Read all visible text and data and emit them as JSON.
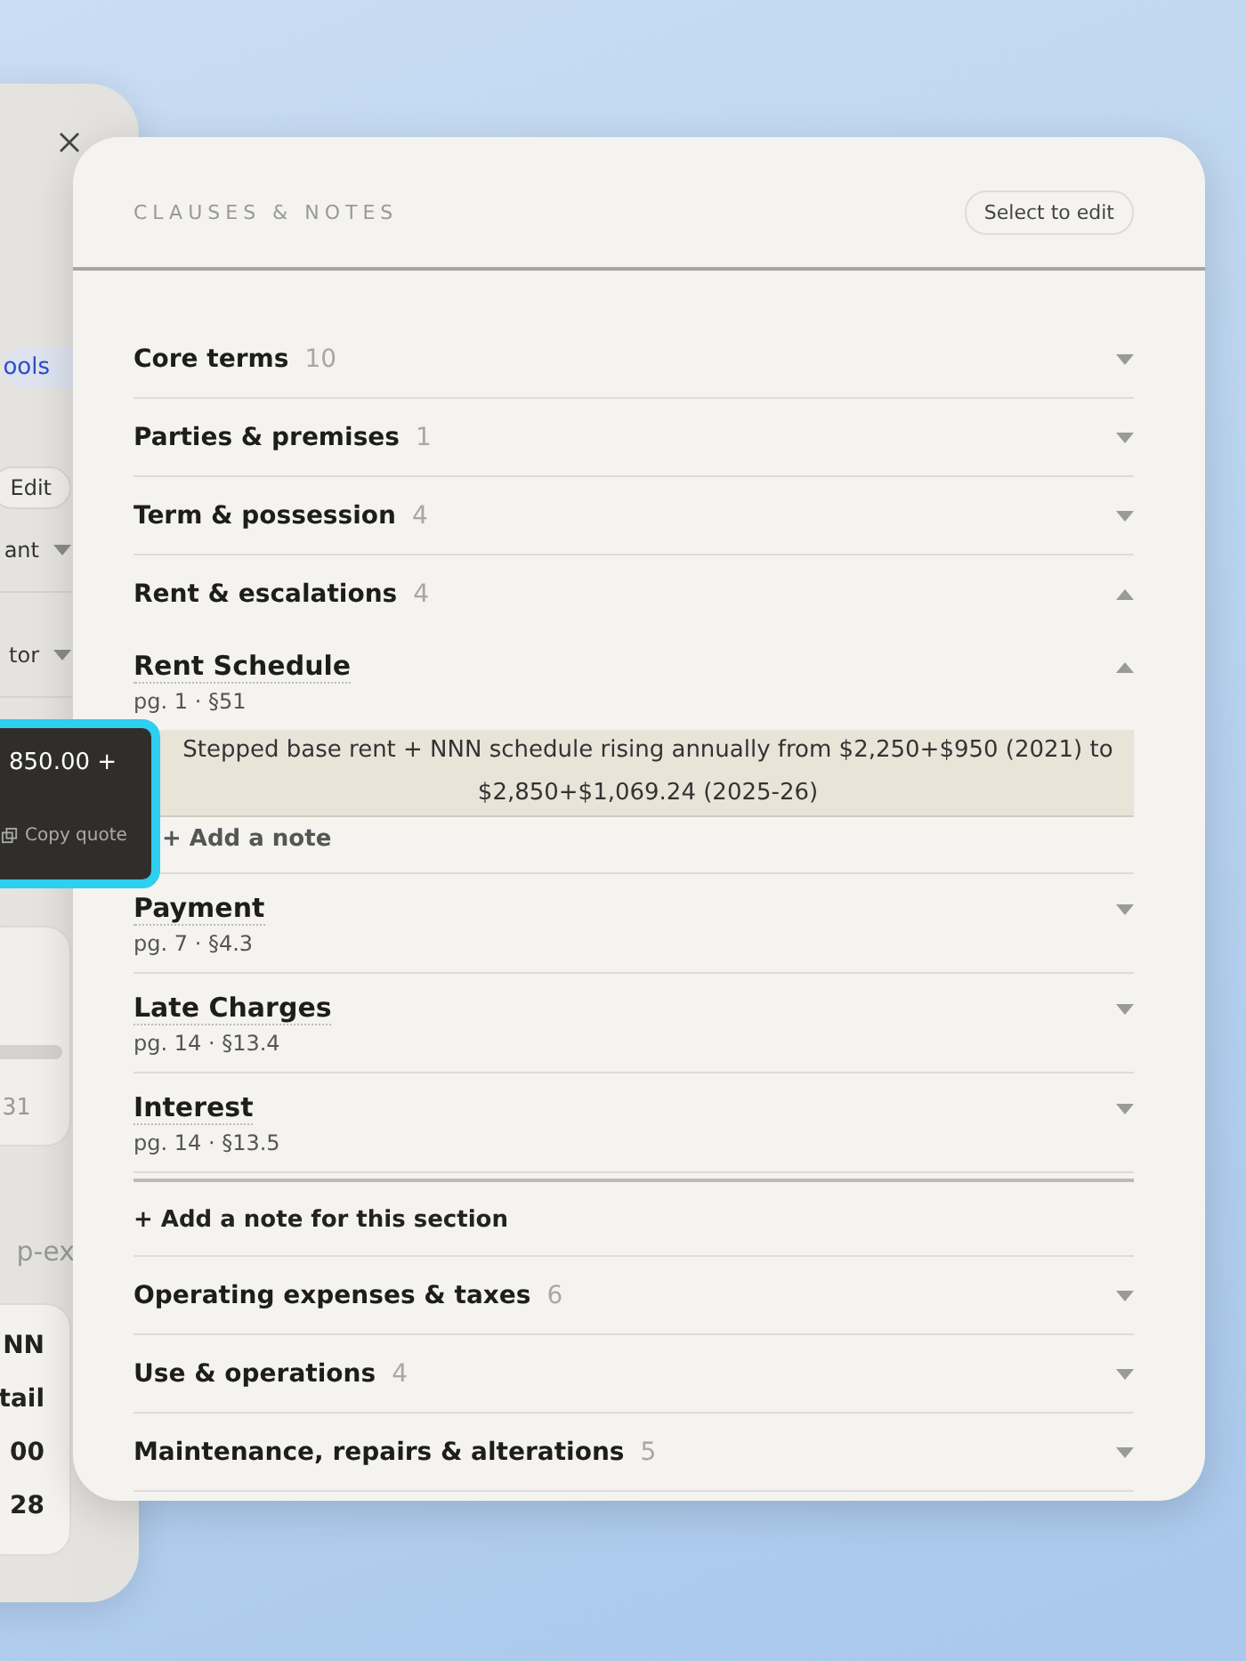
{
  "back_panel": {
    "tab_chip": "ools",
    "edit_button": "Edit",
    "dropdowns": [
      "ant",
      "tor"
    ],
    "card_value": "31",
    "section_label": "p-ex",
    "summary_lines": [
      "NN",
      "tail",
      "00",
      "28"
    ]
  },
  "tooltip": {
    "amount": "850.00 +",
    "copy_button": "Copy quote"
  },
  "panel": {
    "title": "CLAUSES & NOTES",
    "edit_button": "Select to edit",
    "sections": [
      {
        "title": "Core terms",
        "count": "10",
        "expanded": false
      },
      {
        "title": "Parties & premises",
        "count": "1",
        "expanded": false
      },
      {
        "title": "Term & possession",
        "count": "4",
        "expanded": false
      },
      {
        "title": "Rent & escalations",
        "count": "4",
        "expanded": true,
        "clauses": [
          {
            "title": "Rent Schedule",
            "ref": "pg. 1 · §51",
            "expanded": true,
            "quote": "Stepped base rent + NNN schedule rising annually from $2,250+$950 (2021) to $2,850+$1,069.24 (2025-26)",
            "add_note": "+ Add a note"
          },
          {
            "title": "Payment",
            "ref": "pg. 7 · §4.3",
            "expanded": false
          },
          {
            "title": "Late Charges",
            "ref": "pg. 14 · §13.4",
            "expanded": false
          },
          {
            "title": "Interest",
            "ref": "pg. 14 · §13.5",
            "expanded": false
          }
        ],
        "section_note": "+ Add a note for this section"
      },
      {
        "title": "Operating expenses & taxes",
        "count": "6",
        "expanded": false
      },
      {
        "title": "Use & operations",
        "count": "4",
        "expanded": false
      },
      {
        "title": "Maintenance, repairs & alterations",
        "count": "5",
        "expanded": false
      }
    ]
  }
}
